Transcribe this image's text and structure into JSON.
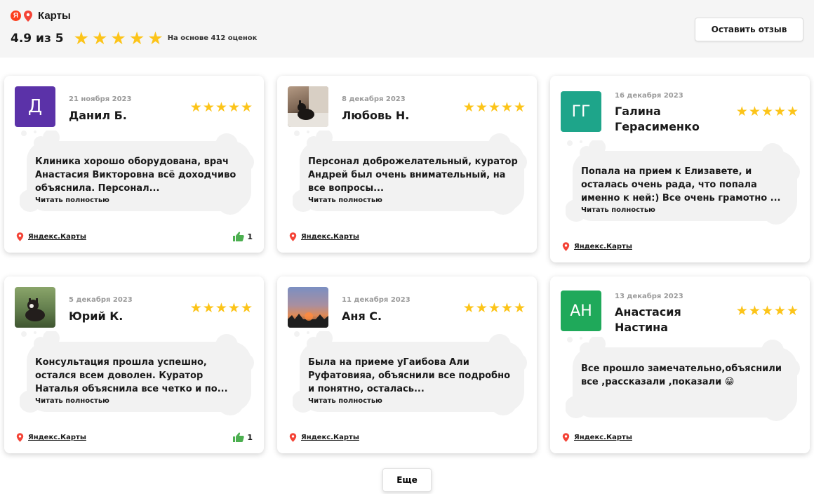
{
  "header": {
    "brand_label": "Карты",
    "ya_letter": "Я",
    "rating_value": "4.9 из 5",
    "rating_stars": 5,
    "based_on": "На основе 412 оценок",
    "leave_review_label": "Оставить отзыв"
  },
  "colors": {
    "star": "#fcc419",
    "pin": "#f44336",
    "like": "#4caf50",
    "bubble": "#f2f2f2"
  },
  "reviews": [
    {
      "date": "21 ноября 2023",
      "name": "Данил Б.",
      "avatar_letters": "Д",
      "avatar_color": "#5b32a8",
      "stars": 5,
      "text": "Клиника хорошо оборудована, врач Анастасия Викторовна всё доходчиво объяснила. Персонал...",
      "read_more": "Читать полностью",
      "source": "Яндекс.Карты",
      "likes": "1"
    },
    {
      "date": "8 декабря 2023",
      "name": "Любовь Н.",
      "avatar_letters": "",
      "avatar_color": "#7a6a5a",
      "stars": 5,
      "text": "Персонал доброжелательный, куратор Андрей был очень внимательный, на все вопросы...",
      "read_more": "Читать полностью",
      "source": "Яндекс.Карты",
      "likes": ""
    },
    {
      "date": "16 декабря 2023",
      "name": "Галина Герасименко",
      "avatar_letters": "ГГ",
      "avatar_color": "#1ea58a",
      "stars": 5,
      "text": "Попала на прием к Елизавете, и осталась очень рада, что попала именно к ней:) Все очень грамотно ...",
      "read_more": "Читать полностью",
      "source": "Яндекс.Карты",
      "likes": ""
    },
    {
      "date": "5 декабря 2023",
      "name": "Юрий К.",
      "avatar_letters": "",
      "avatar_color": "#5f7a4a",
      "stars": 5,
      "text": "Консультация прошла успешно, остался всем доволен. Куратор Наталья объяснила все четко и по...",
      "read_more": "Читать полностью",
      "source": "Яндекс.Карты",
      "likes": "1"
    },
    {
      "date": "11 декабря 2023",
      "name": "Аня С.",
      "avatar_letters": "",
      "avatar_color": "#6d7fb3",
      "stars": 5,
      "text": "Была на приеме уГаибова Али Руфатовияа, объяснили все подробно и понятно, осталась...",
      "read_more": "Читать полностью",
      "source": "Яндекс.Карты",
      "likes": ""
    },
    {
      "date": "13 декабря 2023",
      "name": "Анастасия Настина",
      "avatar_letters": "АН",
      "avatar_color": "#1fa95a",
      "stars": 5,
      "text": "Все прошло замечательно,объяснили все ,рассказали ,показали 😁",
      "read_more": "",
      "source": "Яндекс.Карты",
      "likes": ""
    }
  ],
  "more_button_label": "Еще"
}
